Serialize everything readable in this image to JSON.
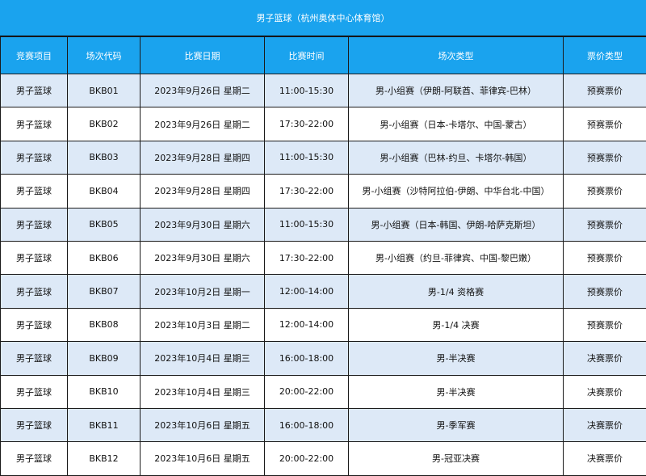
{
  "title": "男子篮球（杭州奥体中心体育馆）",
  "columns": [
    "竞赛项目",
    "场次代码",
    "比赛日期",
    "比赛时间",
    "场次类型",
    "票价类型"
  ],
  "rows": [
    [
      "男子篮球",
      "BKB01",
      "2023年9月26日 星期二",
      "11:00-15:30",
      "男-小组赛（伊朗-阿联酋、菲律宾-巴林）",
      "预赛票价"
    ],
    [
      "男子篮球",
      "BKB02",
      "2023年9月26日 星期二",
      "17:30-22:00",
      "男-小组赛（日本-卡塔尔、中国-蒙古）",
      "预赛票价"
    ],
    [
      "男子篮球",
      "BKB03",
      "2023年9月28日 星期四",
      "11:00-15:30",
      "男-小组赛（巴林-约旦、卡塔尔-韩国）",
      "预赛票价"
    ],
    [
      "男子篮球",
      "BKB04",
      "2023年9月28日 星期四",
      "17:30-22:00",
      "男-小组赛（沙特阿拉伯-伊朗、中华台北-中国）",
      "预赛票价"
    ],
    [
      "男子篮球",
      "BKB05",
      "2023年9月30日 星期六",
      "11:00-15:30",
      "男-小组赛（日本-韩国、伊朗-哈萨克斯坦）",
      "预赛票价"
    ],
    [
      "男子篮球",
      "BKB06",
      "2023年9月30日 星期六",
      "17:30-22:00",
      "男-小组赛（约旦-菲律宾、中国-黎巴嫩）",
      "预赛票价"
    ],
    [
      "男子篮球",
      "BKB07",
      "2023年10月2日 星期一",
      "12:00-14:00",
      "男-1/4 资格赛",
      "预赛票价"
    ],
    [
      "男子篮球",
      "BKB08",
      "2023年10月3日 星期二",
      "12:00-14:00",
      "男-1/4 决赛",
      "预赛票价"
    ],
    [
      "男子篮球",
      "BKB09",
      "2023年10月4日 星期三",
      "16:00-18:00",
      "男-半决赛",
      "决赛票价"
    ],
    [
      "男子篮球",
      "BKB10",
      "2023年10月4日 星期三",
      "20:00-22:00",
      "男-半决赛",
      "决赛票价"
    ],
    [
      "男子篮球",
      "BKB11",
      "2023年10月6日 星期五",
      "16:00-18:00",
      "男-季军赛",
      "决赛票价"
    ],
    [
      "男子篮球",
      "BKB12",
      "2023年10月6日 星期五",
      "20:00-22:00",
      "男-冠亚决赛",
      "决赛票价"
    ]
  ],
  "colors": {
    "header_bg": "#1aa3ee",
    "header_text": "#ffffff",
    "stripe_row": "#dde9f7",
    "plain_row": "#ffffff",
    "border": "#1b1b1b"
  }
}
